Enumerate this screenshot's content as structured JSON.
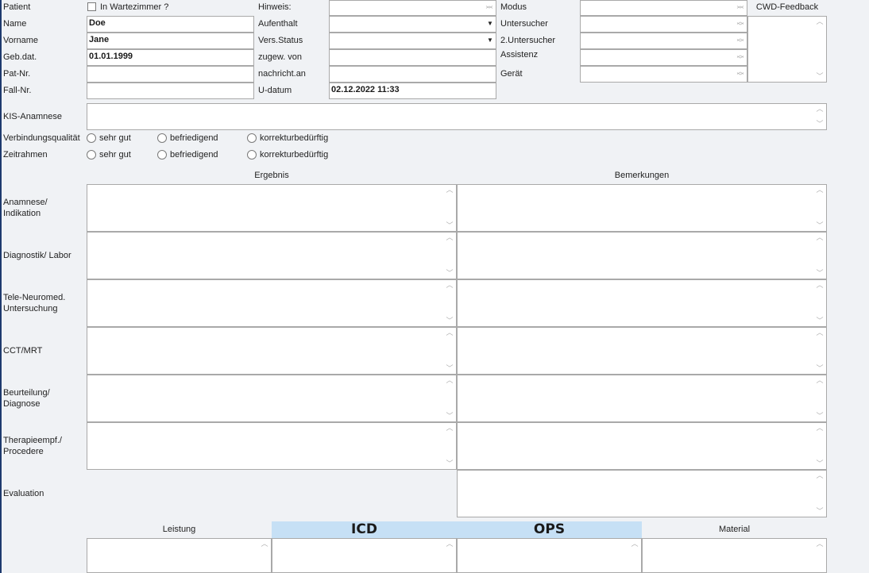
{
  "patient": {
    "label": "Patient",
    "waiting_room_label": "In Wartezimmer ?",
    "name_label": "Name",
    "name_value": "Doe",
    "firstname_label": "Vorname",
    "firstname_value": "Jane",
    "dob_label": "Geb.dat.",
    "dob_value": "01.01.1999",
    "patno_label": "Pat-Nr.",
    "patno_value": "",
    "caseno_label": "Fall-Nr.",
    "caseno_value": ""
  },
  "middle": {
    "hint_label": "Hinweis:",
    "stay_label": "Aufenthalt",
    "ins_label": "Vers.Status",
    "referred_label": "zugew. von",
    "notify_label": "nachricht.an",
    "udate_label": "U-datum",
    "udate_value": "02.12.2022 11:33"
  },
  "right": {
    "mode_label": "Modus",
    "examiner_label": "Untersucher",
    "examiner2_label": "2.Untersucher",
    "assist_label": "Assistenz",
    "device_label": "Gerät",
    "feedback_label": "CWD-Feedback"
  },
  "kis_label": "KIS-Anamnese",
  "quality": {
    "conn_label": "Verbindungsqualität",
    "time_label": "Zeitrahmen",
    "options": [
      "sehr gut",
      "befriedigend",
      "korrekturbedürftig"
    ]
  },
  "columns": {
    "result": "Ergebnis",
    "remarks": "Bemerkungen"
  },
  "rows": [
    {
      "l1": "Anamnese/",
      "l2": "Indikation"
    },
    {
      "l1": "Diagnostik/ Labor",
      "l2": ""
    },
    {
      "l1": "Tele-Neuromed.",
      "l2": "Untersuchung"
    },
    {
      "l1": "CCT/MRT",
      "l2": ""
    },
    {
      "l1": "Beurteilung/",
      "l2": "Diagnose"
    },
    {
      "l1": "Therapieempf./",
      "l2": "Procedere"
    }
  ],
  "evaluation_label": "Evaluation",
  "bottom": {
    "service": "Leistung",
    "icd": "ICD",
    "ops": "OPS",
    "material": "Material"
  },
  "colors": {
    "header_bg": "#c6e0f5",
    "left_border": "#1e3a6e"
  },
  "icons": {
    "scroll_up": "chevron-up-icon",
    "scroll_down": "chevron-down-icon",
    "dropdown": "caret-down-icon"
  }
}
